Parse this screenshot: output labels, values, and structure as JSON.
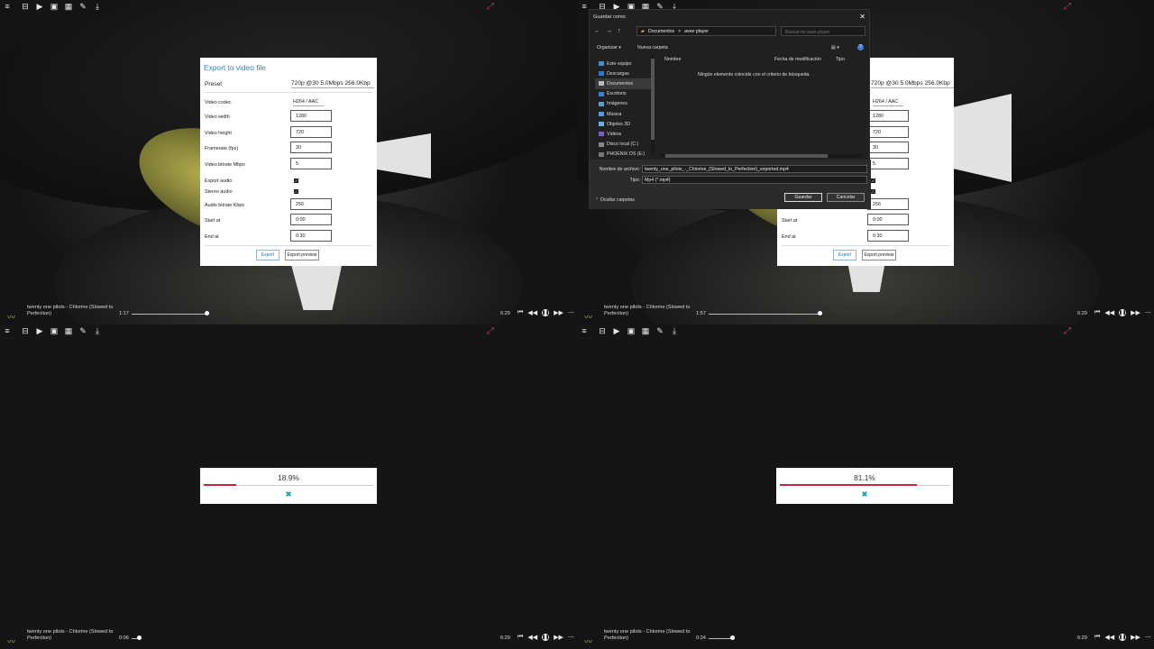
{
  "toolbar_icons": [
    "menu-icon",
    "inbox-icon",
    "play-icon",
    "image-icon",
    "grid-icon",
    "brush-icon",
    "download-icon"
  ],
  "toolbar_glyphs": [
    "≡",
    "⊟",
    "▶",
    "▣",
    "▦",
    "✎",
    "⤓"
  ],
  "resize_glyph": "⤢",
  "player": {
    "song_title": "twenty one pilots - Chlorine (Slowed to Perfection)",
    "total_time": "6:29",
    "times": [
      "1:17",
      "1:57",
      "0:06",
      "0:24"
    ],
    "progress": [
      0.18,
      0.3,
      0.015,
      0.062
    ]
  },
  "export_dialog": {
    "title": "Export to video file",
    "preset_label": "Preset",
    "preset_value": "720p @30 5.0Mbps 256.0Kbp",
    "codec_label": "Video codec",
    "codec_value": "H264 / AAC",
    "width_label": "Video width",
    "width_value": "1280",
    "height_label": "Video height",
    "height_value": "720",
    "fps_label": "Framerate (fps)",
    "fps_value": "30",
    "bitrate_label": "Video bitrate Mbps",
    "bitrate_value": "5",
    "export_audio_label": "Export audio",
    "stereo_label": "Stereo audio",
    "audio_bitrate_label": "Audio bitrate Kbps",
    "audio_bitrate_value": "256",
    "start_label": "Start at",
    "start_value": "0:00",
    "end_label": "End at",
    "end_value": "0:30",
    "export_button": "Export",
    "preview_button": "Export preview"
  },
  "save_dialog": {
    "title": "Guardar como",
    "path_root": "Documentos",
    "path_sep": ">",
    "path_leaf": "avee player",
    "search_placeholder": "Buscar en avee player",
    "organize": "Organizar ▾",
    "new_folder": "Nueva carpeta",
    "sidebar": [
      "Este equipo",
      "Descargas",
      "Documentos",
      "Escritorio",
      "Imágenes",
      "Música",
      "Objetos 3D",
      "Vídeos",
      "Disco local (C:)",
      "PHOENIX OS (E:)"
    ],
    "col_name": "Nombre",
    "col_date": "Fecha de modificación",
    "col_type": "Tipo",
    "empty_message": "Ningún elemento coincide con el criterio de búsqueda.",
    "filename_label": "Nombre de archivo:",
    "filename_value": "twenty_one_pilots_-_Chlorine_(Slowed_to_Perfection)_exported.mp4",
    "type_label": "Tipo:",
    "type_value": "Mp4 (*.mp4)",
    "hide_folders": "Ocultar carpetas",
    "save_button": "Guardar",
    "cancel_button": "Cancelar"
  },
  "export_progress": [
    {
      "percent_text": "18.9%",
      "value": 0.189
    },
    {
      "percent_text": "81.1%",
      "value": 0.811
    }
  ],
  "cancel_glyph": "✖",
  "colors": {
    "accent_blue": "#3a83c4",
    "progress_red": "#d0223f",
    "cancel_teal": "#1da3b7",
    "resize_pink": "#c23a7a"
  }
}
